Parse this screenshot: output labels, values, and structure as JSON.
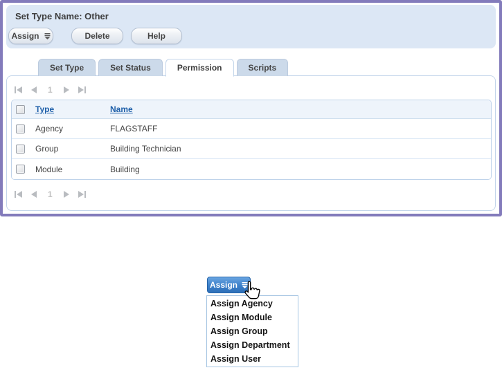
{
  "panel": {
    "title": "Set Type Name: Other",
    "toolbar": {
      "assign_label": "Assign",
      "delete_label": "Delete",
      "help_label": "Help"
    },
    "tabs": [
      {
        "label": "Set Type",
        "active": false
      },
      {
        "label": "Set Status",
        "active": false
      },
      {
        "label": "Permission",
        "active": true
      },
      {
        "label": "Scripts",
        "active": false
      }
    ],
    "pager": {
      "page": "1"
    },
    "table": {
      "columns": [
        "Type",
        "Name"
      ],
      "rows": [
        {
          "type": "Agency",
          "name": "FLAGSTAFF"
        },
        {
          "type": "Group",
          "name": "Building Technician"
        },
        {
          "type": "Module",
          "name": "Building"
        }
      ]
    }
  },
  "dropdown": {
    "button_label": "Assign",
    "items": [
      "Assign Agency",
      "Assign Module",
      "Assign Group",
      "Assign Department",
      "Assign User"
    ]
  },
  "icons": {
    "split_arrow": "split-arrow-icon",
    "cursor": "cursor-hand-icon",
    "pager": [
      "first-page-icon",
      "prev-page-icon",
      "next-page-icon",
      "last-page-icon"
    ]
  },
  "colors": {
    "accent_purple": "#837bbb",
    "header_bg": "#dce7f5",
    "tab_inactive_bg": "#ccdaea",
    "link_blue": "#1e5fa9",
    "active_button_blue": "#3b80ca",
    "menu_border": "#a4c4e2",
    "grid_border": "#bfd3ea"
  }
}
